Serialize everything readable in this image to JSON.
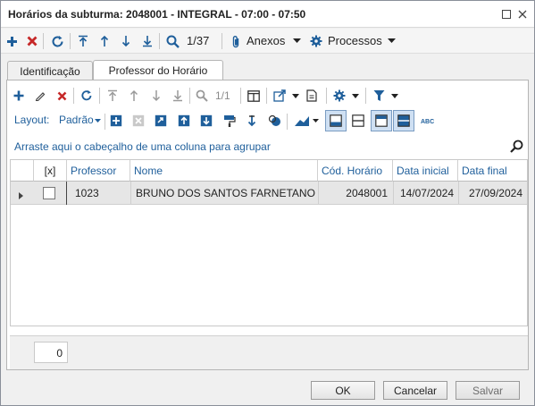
{
  "window": {
    "title": "Horários da subturma: 2048001 - INTEGRAL - 07:00 - 07:50"
  },
  "toolbar": {
    "record_counter": "1/37",
    "anexos_label": "Anexos",
    "processos_label": "Processos"
  },
  "tabs": [
    {
      "label": "Identificação",
      "active": false
    },
    {
      "label": "Professor do Horário",
      "active": true
    }
  ],
  "grid_toolbar": {
    "counter": "1/1",
    "layout_label": "Layout:",
    "layout_value": "Padrão"
  },
  "group_hint": "Arraste aqui o cabeçalho de uma coluna para agrupar",
  "table": {
    "columns": [
      "[x]",
      "Professor",
      "Nome",
      "Cód. Horário",
      "Data inicial",
      "Data final"
    ],
    "rows": [
      {
        "checked": false,
        "professor": "1023",
        "nome": "BRUNO DOS SANTOS FARNETANO",
        "cod_horario": "2048001",
        "data_inicial": "14/07/2024",
        "data_final": "27/09/2024"
      }
    ]
  },
  "footer": {
    "count": "0"
  },
  "buttons": {
    "ok": "OK",
    "cancel": "Cancelar",
    "save": "Salvar"
  },
  "colors": {
    "accent_blue": "#1f5f9b",
    "delete_red": "#c62828",
    "row_selected": "#e6e6e6"
  }
}
